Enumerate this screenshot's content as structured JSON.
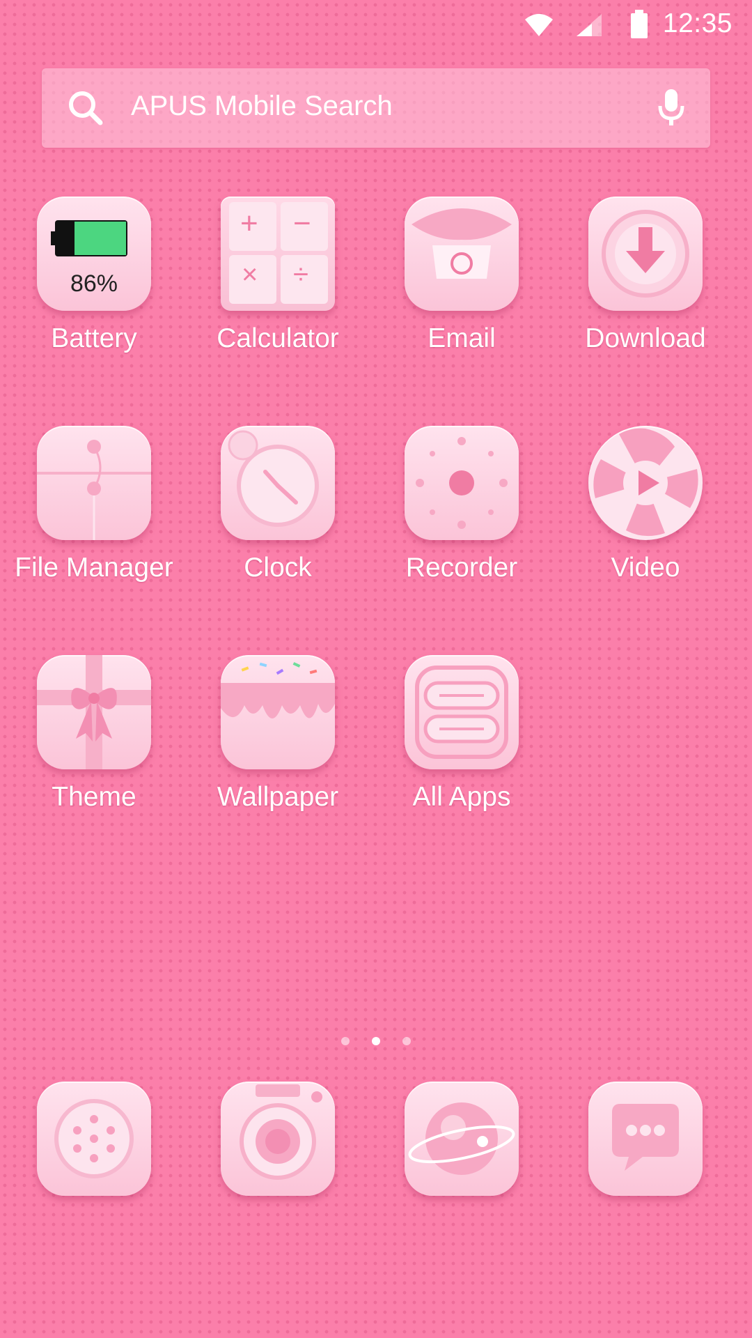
{
  "status_bar": {
    "time": "12:35",
    "icons": [
      "wifi-icon",
      "cellular-signal-icon",
      "battery-icon"
    ]
  },
  "search": {
    "placeholder": "APUS Mobile Search",
    "icons": [
      "search-icon",
      "microphone-icon"
    ]
  },
  "apps": [
    {
      "label": "Battery",
      "icon": "battery-app-icon",
      "value": "86%",
      "level": 0.86
    },
    {
      "label": "Calculator",
      "icon": "calculator-icon",
      "symbols": [
        "+",
        "−",
        "×",
        "÷"
      ]
    },
    {
      "label": "Email",
      "icon": "email-envelope-icon"
    },
    {
      "label": "Download",
      "icon": "download-arrow-icon"
    },
    {
      "label": "File Manager",
      "icon": "folder-icon"
    },
    {
      "label": "Clock",
      "icon": "clock-icon"
    },
    {
      "label": "Recorder",
      "icon": "recorder-icon"
    },
    {
      "label": "Video",
      "icon": "video-play-icon"
    },
    {
      "label": "Theme",
      "icon": "gift-bow-icon"
    },
    {
      "label": "Wallpaper",
      "icon": "cake-icing-icon"
    },
    {
      "label": "All Apps",
      "icon": "all-apps-icon"
    }
  ],
  "page_indicator": {
    "count": 3,
    "active": 1
  },
  "dock": [
    {
      "icon": "phone-dialer-icon"
    },
    {
      "icon": "camera-icon"
    },
    {
      "icon": "browser-planet-icon"
    },
    {
      "icon": "messaging-bubble-icon"
    }
  ],
  "colors": {
    "background": "#fb7faa",
    "tile": "#fbc4d8",
    "accent": "#f26c9a",
    "battery_green": "#4cd680"
  }
}
